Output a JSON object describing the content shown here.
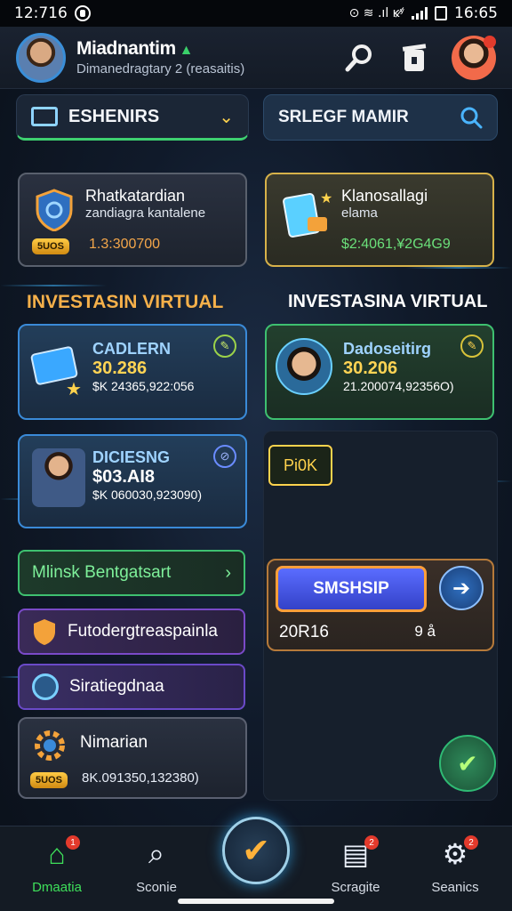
{
  "status": {
    "time": "12:716",
    "icons_right": "⊙ ≋ .ıl ĸʸ̸",
    "time_right": "16:65"
  },
  "header": {
    "name": "Miadnantim",
    "subtitle": "Dimanedragtary 2 (reasaitis)"
  },
  "filter": {
    "label": "ESHENIRS"
  },
  "search": {
    "label": "SRLEGF MAMIR"
  },
  "cards": {
    "left": {
      "title": "Rhatkatardian",
      "sub": "zandiagra kantalene",
      "pill": "5UOS",
      "value": "1.3:300700"
    },
    "right": {
      "title": "Klanosallagi",
      "sub": "elama",
      "value": "$2:4061,¥2G4G9"
    }
  },
  "sections": {
    "left_title": "INVESTASIN VIRTUAL",
    "right_title": "INVESTASINA VIRTUAL"
  },
  "investments": [
    {
      "name": "CADLERN",
      "value": "30.286",
      "sub": "$K 24365,922:056"
    },
    {
      "name": "Dadoseitirg",
      "value": "30.206",
      "sub": "21.200074,92356O)"
    },
    {
      "name": "DICIESNG",
      "value": "$03.AI8",
      "sub": "$K 060030,923090)"
    }
  ],
  "tag": "Pi0K",
  "list": [
    {
      "label": "Mlinsk Bentgatsart"
    },
    {
      "label": "Futodergtreaspainla"
    },
    {
      "label": "Siratiegdnaa"
    }
  ],
  "bottom_card": {
    "title": "Nimarian",
    "pill": "5UOS",
    "value": "8K.091350,132380)"
  },
  "promo": {
    "button": "SMSHSIP",
    "left": "20R16",
    "right": "9 å"
  },
  "nav": [
    {
      "label": "Dmaatia",
      "badge": "1"
    },
    {
      "label": "Sconie"
    },
    {
      "label": "Scragite",
      "badge": "2"
    },
    {
      "label": "Seanics",
      "badge": "2"
    }
  ]
}
